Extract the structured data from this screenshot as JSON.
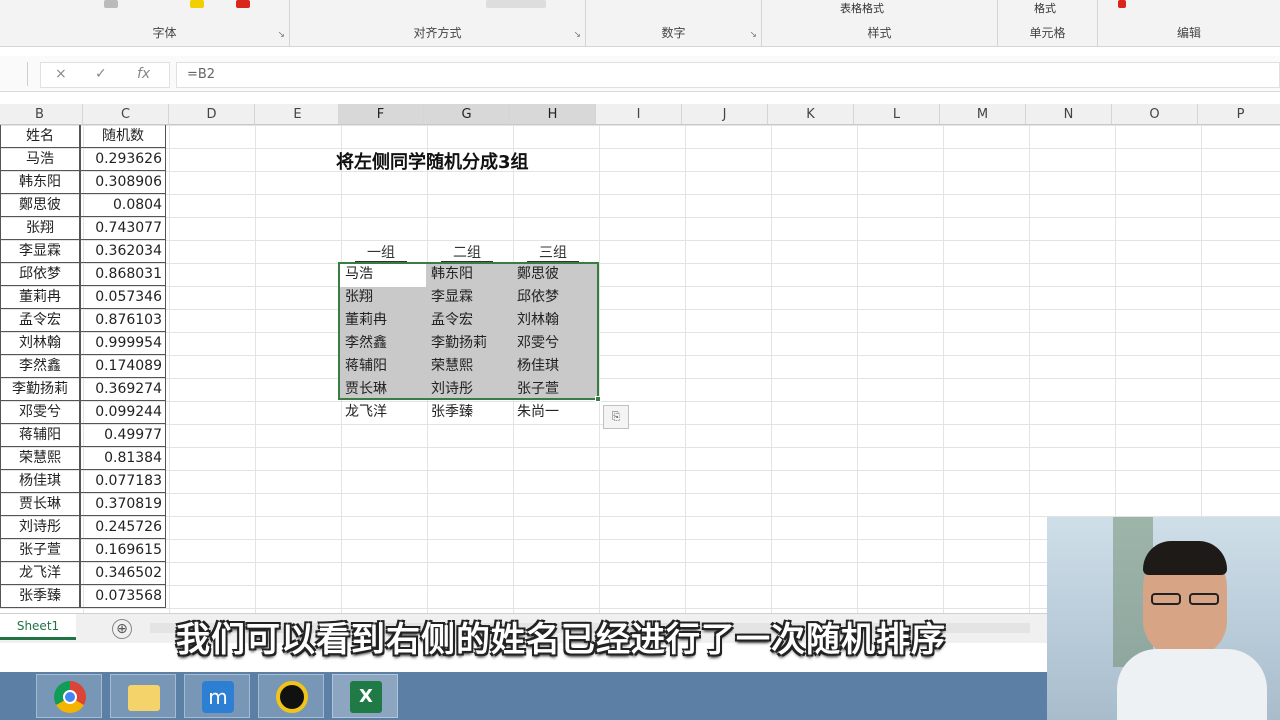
{
  "ribbon": {
    "groups": [
      {
        "label": "字体"
      },
      {
        "label": "对齐方式"
      },
      {
        "label": "数字"
      },
      {
        "label": "样式",
        "button": "表格格式"
      },
      {
        "label": "单元格",
        "button": "格式"
      },
      {
        "label": "编辑"
      }
    ]
  },
  "formula_bar": {
    "cancel_glyph": "×",
    "enter_glyph": "✓",
    "fx_glyph": "fx",
    "value": "=B2"
  },
  "columns": [
    "B",
    "C",
    "D",
    "E",
    "F",
    "G",
    "H",
    "I",
    "J",
    "K",
    "L",
    "M",
    "N",
    "O",
    "P"
  ],
  "list": {
    "header_name": "姓名",
    "header_rand": "随机数",
    "rows": [
      {
        "name": "马浩",
        "rand": "0.293626"
      },
      {
        "name": "韩东阳",
        "rand": "0.308906"
      },
      {
        "name": "鄭思彼",
        "rand": "0.0804"
      },
      {
        "name": "张翔",
        "rand": "0.743077"
      },
      {
        "name": "李显霖",
        "rand": "0.362034"
      },
      {
        "name": "邱依梦",
        "rand": "0.868031"
      },
      {
        "name": "董莉冉",
        "rand": "0.057346"
      },
      {
        "name": "孟令宏",
        "rand": "0.876103"
      },
      {
        "name": "刘林翰",
        "rand": "0.999954"
      },
      {
        "name": "李然鑫",
        "rand": "0.174089"
      },
      {
        "name": "李勤扬莉",
        "rand": "0.369274"
      },
      {
        "name": "邓雯兮",
        "rand": "0.099244"
      },
      {
        "name": "蒋辅阳",
        "rand": "0.49977"
      },
      {
        "name": "荣慧熙",
        "rand": "0.81384"
      },
      {
        "name": "杨佳琪",
        "rand": "0.077183"
      },
      {
        "name": "贾长琳",
        "rand": "0.370819"
      },
      {
        "name": "刘诗彤",
        "rand": "0.245726"
      },
      {
        "name": "张子萱",
        "rand": "0.169615"
      },
      {
        "name": "龙飞洋",
        "rand": "0.346502"
      },
      {
        "name": "张季臻",
        "rand": "0.073568"
      }
    ]
  },
  "title": "将左侧同学随机分成3组",
  "groups": {
    "headers": [
      "一组",
      "二组",
      "三组"
    ],
    "rows": [
      [
        "马浩",
        "韩东阳",
        "鄭思彼"
      ],
      [
        "张翔",
        "李显霖",
        "邱依梦"
      ],
      [
        "董莉冉",
        "孟令宏",
        "刘林翰"
      ],
      [
        "李然鑫",
        "李勤扬莉",
        "邓雯兮"
      ],
      [
        "蒋辅阳",
        "荣慧熙",
        "杨佳琪"
      ],
      [
        "贾长琳",
        "刘诗彤",
        "张子萱"
      ],
      [
        "龙飞洋",
        "张季臻",
        "朱尚一"
      ]
    ]
  },
  "sheet": {
    "tab": "Sheet1",
    "add": "⊕"
  },
  "subtitle": "我们可以看到右侧的姓名已经进行了一次随机排序",
  "taskbar": {
    "apps": [
      {
        "icon": "chrome-icon"
      },
      {
        "icon": "file-explorer-icon"
      },
      {
        "icon": "maxthon-browser-icon"
      },
      {
        "icon": "recorder-icon"
      },
      {
        "icon": "excel-icon"
      }
    ]
  }
}
